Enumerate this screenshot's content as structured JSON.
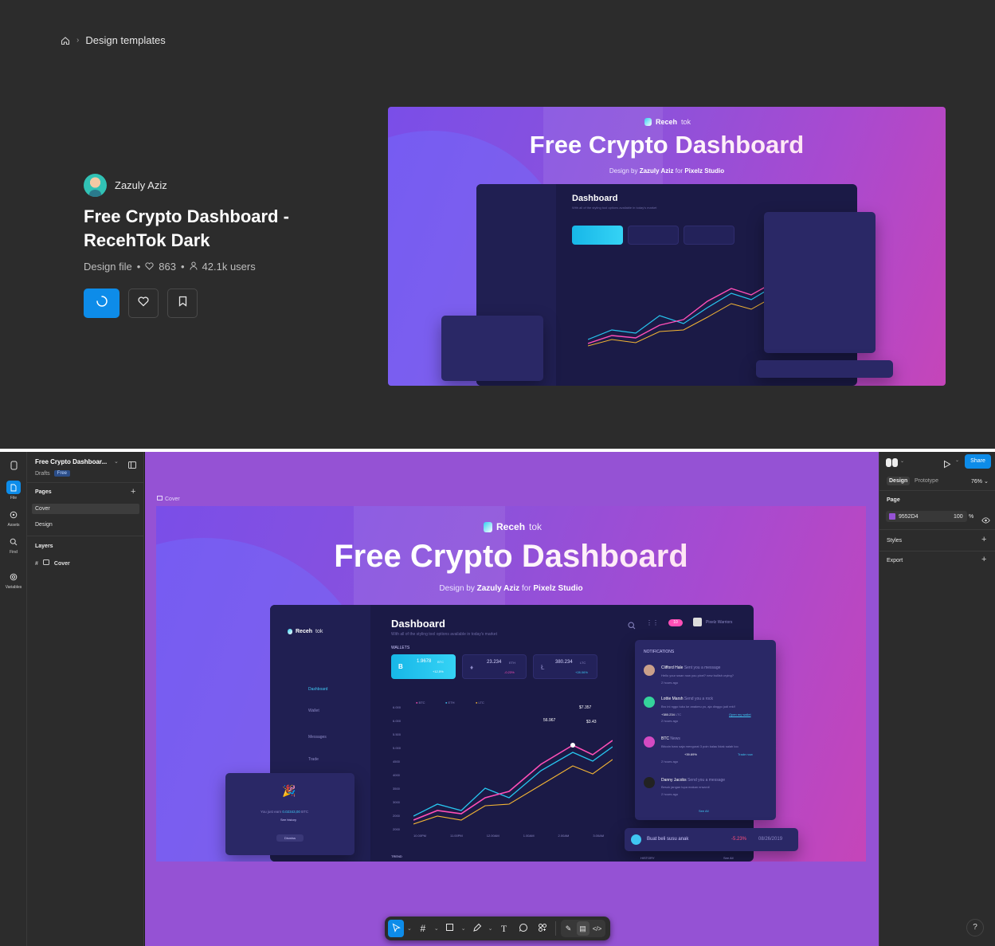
{
  "breadcrumb": {
    "current": "Design templates"
  },
  "file": {
    "author": "Zazuly Aziz",
    "title": "Free Crypto Dashboard - RecehTok Dark",
    "type": "Design file",
    "likes": "863",
    "users": "42.1k users"
  },
  "cover": {
    "brand": "Receh",
    "brand_suffix": "tok",
    "headline": "Free Crypto Dashboard",
    "by_prefix": "Design by",
    "by_author": "Zazuly Aziz",
    "by_mid": "for",
    "by_studio": "Pixelz Studio",
    "dashboard": {
      "title": "Dashboard",
      "subtitle": "With all of the styling tool options available in today's market",
      "wallets_label": "WALLETS",
      "trend_label": "TREND",
      "nav": [
        "Dashboard",
        "Wallet",
        "Messages",
        "Trade"
      ],
      "wallets": [
        {
          "coin": "B",
          "value": "1.9678",
          "unit": "BTC",
          "change": "+12,5%"
        },
        {
          "coin": "♦",
          "value": "23.234",
          "unit": "ETH",
          "change": "-0.23%"
        },
        {
          "coin": "Ł",
          "value": "380.234",
          "unit": "LTC",
          "change": "+28.06%"
        }
      ],
      "legend": [
        "BTC",
        "ETH",
        "LTC"
      ],
      "points": [
        "$7.357",
        "56.967",
        "$3.43"
      ],
      "y_ticks": [
        "6.000",
        "6.000",
        "5.500",
        "5.000",
        "4500",
        "4000",
        "3500",
        "3000",
        "2000",
        "2000"
      ],
      "x_ticks": [
        "10.00PM",
        "11.00PM",
        "12.00AM",
        "1.00AM",
        "2.00AM",
        "3.00AM",
        "4.00AM"
      ],
      "user": "Pixelz Warriors",
      "badge": "10"
    },
    "notifications": {
      "title": "NOTIFICATIONS",
      "items": [
        {
          "name": "Clifford Hale",
          "action": "Sent you a message",
          "text": "Hello your swan now you pixel? new bullish crying?",
          "time": "2 hours ago"
        },
        {
          "name": "Lottie Marsh",
          "action": "Send you a rock",
          "text": "Bro ini nggo tuku ke anakmu yo, aja dinggo judi rek!!",
          "amount": "+380.234",
          "unit": "LTC",
          "link": "Open my wallet",
          "time": "2 hours ago"
        },
        {
          "name": "BTC",
          "action": "News",
          "text": "Bitcoin baru saja mengurat 3 poin kalau lidak salah loo",
          "change": "+39.69%",
          "link": "Trade now",
          "time": "2 hours ago"
        },
        {
          "name": "Danny Jacobs",
          "action": "Send you a message",
          "text": "Besok jangan lupa makan nnwcnil",
          "time": "2 hours ago"
        }
      ],
      "see_all": "See All"
    },
    "reward": {
      "text": "You just earn",
      "amount": "0.02343,00",
      "unit": "BTC",
      "link": "See history",
      "button": "Dismiss"
    },
    "history": {
      "text": "Buat beli susu anak",
      "change": "-5.23%",
      "date": "08/26/2019",
      "label": "HISTORY",
      "see_all": "See All"
    }
  },
  "editor": {
    "file_title": "Free Crypto Dashboar...",
    "drafts": "Drafts",
    "plan": "Free",
    "pages_label": "Pages",
    "pages": [
      "Cover",
      "Design"
    ],
    "layers_label": "Layers",
    "layer": "Cover",
    "frame_label": "Cover",
    "rail": [
      "File",
      "Assets",
      "Find",
      "Variables"
    ],
    "share": "Share",
    "tabs": [
      "Design",
      "Prototype"
    ],
    "zoom": "76%",
    "page_section": "Page",
    "page_color": "9552D4",
    "page_opacity": "100",
    "page_opacity_unit": "%",
    "styles_label": "Styles",
    "export_label": "Export",
    "help": "?"
  },
  "colors": {
    "accent": "#0d8ce9",
    "canvas": "#9552d4",
    "panel": "#2c2c2c"
  }
}
